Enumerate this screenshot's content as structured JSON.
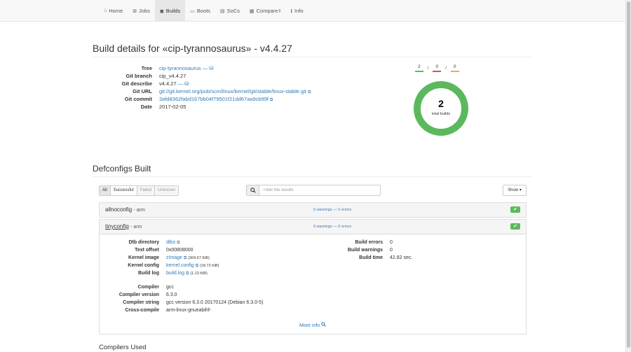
{
  "nav": {
    "items": [
      {
        "label": "Home",
        "icon": "home-icon",
        "glyph": "⌂"
      },
      {
        "label": "Jobs",
        "icon": "sitemap-icon",
        "glyph": "⊞"
      },
      {
        "label": "Builds",
        "icon": "cube-icon",
        "glyph": "◼"
      },
      {
        "label": "Boots",
        "icon": "hdd-icon",
        "glyph": "▭"
      },
      {
        "label": "SoCs",
        "icon": "server-icon",
        "glyph": "▤"
      },
      {
        "label": "Compare",
        "icon": "th-icon",
        "glyph": "▦",
        "badge": "β"
      },
      {
        "label": "Info",
        "icon": "info-icon",
        "glyph": "ℹ"
      }
    ],
    "active": "Builds"
  },
  "page_title": "Build details for «cip-tyrannosaurus» - v4.4.27",
  "details": {
    "tree_label": "Tree",
    "tree_value": "cip-tyrannosaurus",
    "tree_suffix": "—",
    "branch_label": "Git branch",
    "branch_value": "cip_v4.4.27",
    "describe_label": "Git describe",
    "describe_value": "v4.4.27",
    "describe_suffix": "—",
    "url_label": "Git URL",
    "url_value": "git://git.kernel.org/pub/scm/linux/kernel/git/stable/linux-stable.git",
    "commit_label": "Git commit",
    "commit_value": "3afd8362fabd167bb04f79501f21dd67aa9cb99f",
    "date_label": "Date",
    "date_value": "2017-02-05"
  },
  "counts": {
    "success": "2",
    "failed": "0",
    "unknown": "0",
    "sep": "/"
  },
  "donut": {
    "total": "2",
    "label": "total builds",
    "color": "#5cb85c"
  },
  "defconfigs_title": "Defconfigs Built",
  "filters": {
    "all": "All",
    "successful": "Successful",
    "failed": "Failed",
    "unknown": "Unknown"
  },
  "search": {
    "placeholder": "Filter the results"
  },
  "show_button": "Show ▾",
  "panels": [
    {
      "name": "allnoconfig",
      "arch": "- arm",
      "warnings": "0 warnings — 0 errors",
      "status": "✔"
    },
    {
      "name": "tinyconfig",
      "arch": "- arm",
      "warnings": "0 warnings — 0 errors",
      "status": "✔"
    }
  ],
  "tinyconfig": {
    "dtb_label": "Dtb directory",
    "dtb_value": "dtbs",
    "text_label": "Text offset",
    "text_value": "0x00808000",
    "kimage_label": "Kernel image",
    "kimage_value": "zImage",
    "kimage_size": "(304.67 KiB)",
    "kconfig_label": "Kernel config",
    "kconfig_value": "kernel.config",
    "kconfig_size": "(18.72 KiB)",
    "blog_label": "Build log",
    "blog_value": "build.log",
    "blog_size": "(1.13 KiB)",
    "berr_label": "Build errors",
    "berr_value": "0",
    "bwarn_label": "Build warnings",
    "bwarn_value": "0",
    "btime_label": "Build time",
    "btime_value": "42.82 sec.",
    "compiler_label": "Compiler",
    "compiler_value": "gcc",
    "cver_label": "Compiler version",
    "cver_value": "6.3.0",
    "cstr_label": "Compiler string",
    "cstr_value": "gcc version 6.3.0 20170124 (Debian 6.3.0-5)",
    "cross_label": "Cross-compile",
    "cross_value": "arm-linux-gnueabihf-",
    "more_info": "More info"
  },
  "compilers_title": "Compilers Used"
}
